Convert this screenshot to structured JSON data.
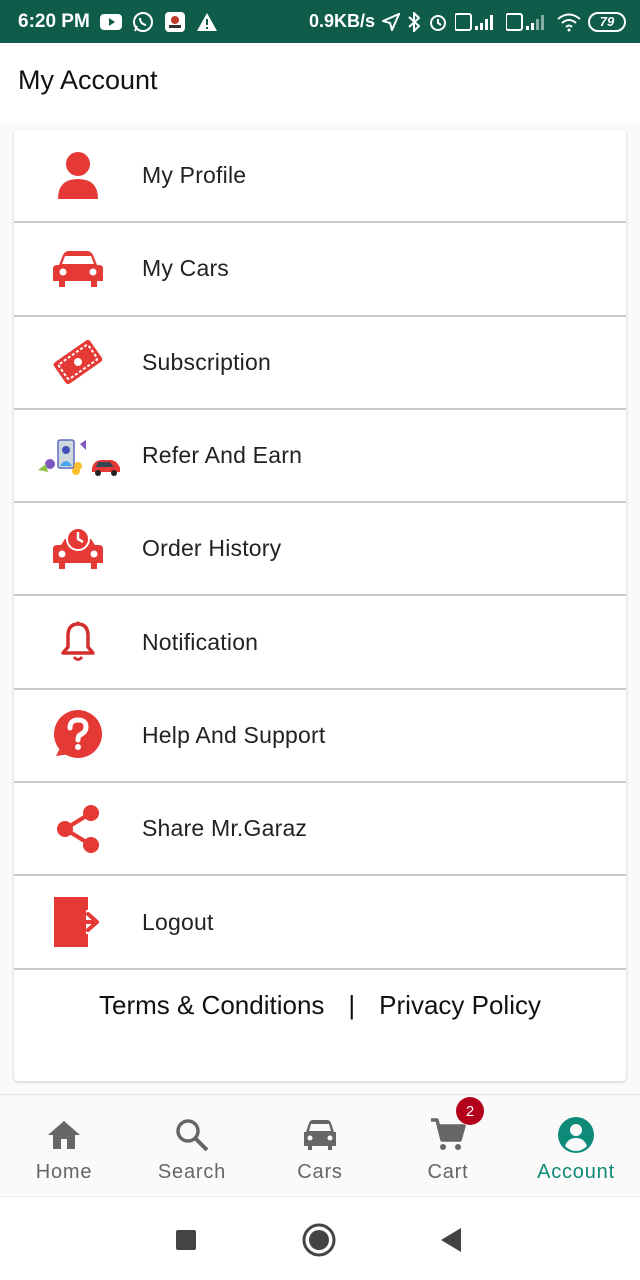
{
  "status_bar": {
    "time": "6:20 PM",
    "speed": "0.9KB/s",
    "battery": "79",
    "bg_color": "#0f5c4b"
  },
  "header": {
    "title": "My Account"
  },
  "menu": [
    {
      "label": "My Profile",
      "icon": "person-icon"
    },
    {
      "label": "My Cars",
      "icon": "car-icon"
    },
    {
      "label": "Subscription",
      "icon": "ticket-icon"
    },
    {
      "label": "Refer And Earn",
      "icon": "refer-illustration-icon"
    },
    {
      "label": "Order History",
      "icon": "car-clock-icon"
    },
    {
      "label": "Notification",
      "icon": "bell-icon"
    },
    {
      "label": "Help And Support",
      "icon": "help-icon"
    },
    {
      "label": "Share Mr.Garaz",
      "icon": "share-icon"
    },
    {
      "label": "Logout",
      "icon": "logout-icon"
    }
  ],
  "footer": {
    "terms": "Terms & Conditions",
    "separator": "|",
    "privacy": "Privacy Policy"
  },
  "bottom_nav": {
    "items": [
      {
        "label": "Home",
        "icon": "home-icon"
      },
      {
        "label": "Search",
        "icon": "search-icon"
      },
      {
        "label": "Cars",
        "icon": "car-icon"
      },
      {
        "label": "Cart",
        "icon": "cart-icon",
        "badge": "2"
      },
      {
        "label": "Account",
        "icon": "account-icon",
        "active": true
      }
    ],
    "active_color": "#0e8a78"
  },
  "colors": {
    "accent_red": "#e53935",
    "active_teal": "#0e8a78",
    "badge_red": "#b3001b"
  }
}
